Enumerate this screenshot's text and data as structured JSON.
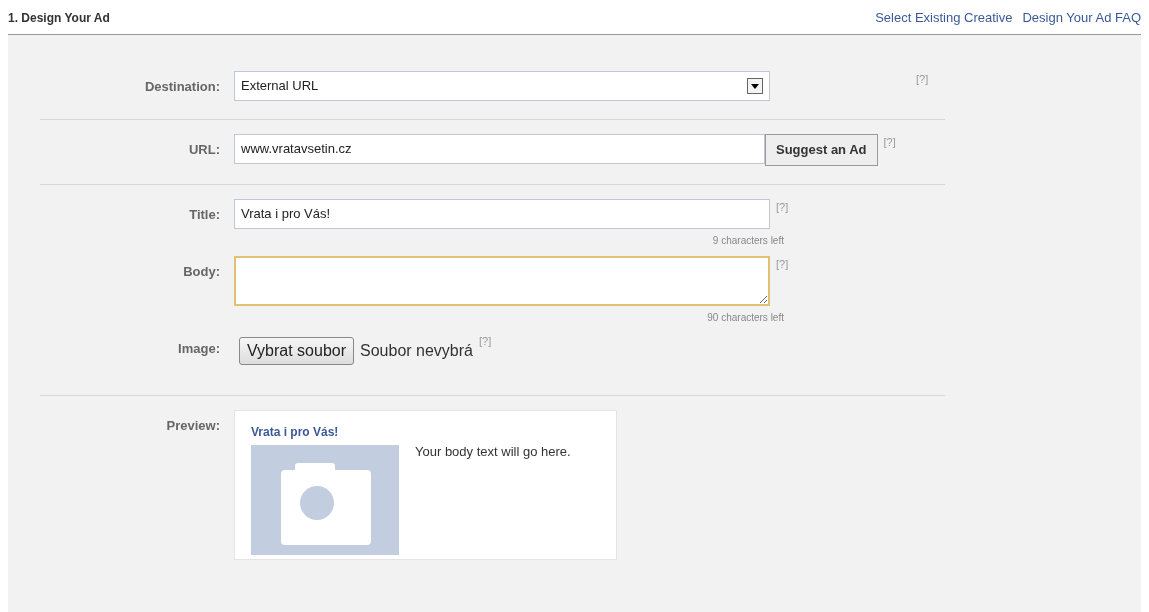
{
  "header": {
    "title": "1. Design Your Ad",
    "links": [
      "Select Existing Creative",
      "Design Your Ad FAQ"
    ]
  },
  "sections": [
    {
      "fields": [
        {
          "kind": "select",
          "label": "Destination:",
          "value": "External URL",
          "help": "[?]"
        }
      ]
    },
    {
      "fields": [
        {
          "kind": "text",
          "label": "URL:",
          "value": "www.vratavsetin.cz",
          "button": "Suggest an Ad",
          "help": "[?]"
        }
      ]
    },
    {
      "fields": [
        {
          "kind": "text",
          "label": "Title:",
          "value": "Vrata i pro Vás!",
          "help": "[?]",
          "counter": "9 characters left"
        },
        {
          "kind": "textarea",
          "label": "Body:",
          "focused": true,
          "help": "[?]",
          "counter": "90 characters left"
        },
        {
          "kind": "file",
          "label": "Image:",
          "button": "Vybrat soubor",
          "status": "Soubor nevybrá",
          "help": "[?]"
        }
      ]
    },
    {
      "fields": [
        {
          "kind": "preview",
          "label": "Preview:",
          "title": "Vrata i pro Vás!",
          "body": "Your body text will go here."
        }
      ]
    }
  ]
}
